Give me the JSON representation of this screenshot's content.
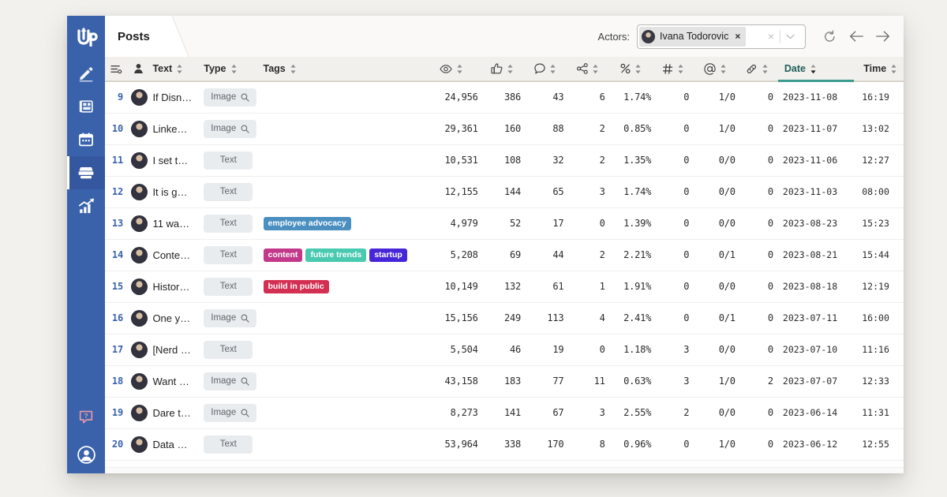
{
  "app": {
    "logo_text": "Up",
    "accent_blue": "#3a62ab",
    "accent_teal": "#3d9a8f"
  },
  "sidebar": {
    "items": [
      {
        "name": "compose",
        "icon": "pencil-icon",
        "active": false
      },
      {
        "name": "layout",
        "icon": "blueprint-icon",
        "active": false
      },
      {
        "name": "calendar",
        "icon": "calendar-icon",
        "active": false
      },
      {
        "name": "posts",
        "icon": "archive-icon",
        "active": true
      },
      {
        "name": "analytics",
        "icon": "bar-chart-icon",
        "active": false
      }
    ],
    "bottom_items": [
      {
        "name": "help",
        "icon": "help-bubble-icon"
      },
      {
        "name": "account",
        "icon": "user-circle-icon"
      }
    ]
  },
  "topbar": {
    "tab_label": "Posts",
    "actors_label": "Actors:",
    "actor_chip": "Ivana Todorovic",
    "chip_remove": "×",
    "select_clear": "×",
    "refresh_title": "Refresh",
    "back_title": "Back",
    "forward_title": "Forward"
  },
  "table": {
    "columns": [
      {
        "key": "settings",
        "label": "",
        "icon": "column-settings-icon",
        "sortable": false
      },
      {
        "key": "actor",
        "label": "",
        "icon": "person-icon",
        "sortable": false
      },
      {
        "key": "text",
        "label": "Text",
        "icon": "",
        "sortable": true
      },
      {
        "key": "type",
        "label": "Type",
        "icon": "",
        "sortable": true
      },
      {
        "key": "tags",
        "label": "Tags",
        "icon": "",
        "sortable": true
      },
      {
        "key": "views",
        "label": "",
        "icon": "eye-icon",
        "sortable": true
      },
      {
        "key": "likes",
        "label": "",
        "icon": "thumbs-up-icon",
        "sortable": true
      },
      {
        "key": "comments",
        "label": "",
        "icon": "comment-icon",
        "sortable": true
      },
      {
        "key": "shares",
        "label": "",
        "icon": "share-icon",
        "sortable": true
      },
      {
        "key": "rate",
        "label": "",
        "icon": "percent-icon",
        "sortable": true
      },
      {
        "key": "hashtags",
        "label": "",
        "icon": "hashtag-icon",
        "sortable": true
      },
      {
        "key": "mentions",
        "label": "",
        "icon": "at-icon",
        "sortable": true
      },
      {
        "key": "links",
        "label": "",
        "icon": "link-icon",
        "sortable": true
      },
      {
        "key": "date",
        "label": "Date",
        "icon": "",
        "sortable": true,
        "sorted": true
      },
      {
        "key": "time",
        "label": "Time",
        "icon": "",
        "sortable": true
      }
    ],
    "rows": [
      {
        "idx": "9",
        "text": "If Disn…",
        "type": "Image",
        "tags": [],
        "views": "24,956",
        "likes": "386",
        "comments": "43",
        "shares": "6",
        "rate": "1.74%",
        "hashtags": "0",
        "mentions": "1/0",
        "links": "0",
        "date": "2023-11-08",
        "time": "16:19"
      },
      {
        "idx": "10",
        "text": "Linke…",
        "type": "Image",
        "tags": [],
        "views": "29,361",
        "likes": "160",
        "comments": "88",
        "shares": "2",
        "rate": "0.85%",
        "hashtags": "0",
        "mentions": "1/0",
        "links": "0",
        "date": "2023-11-07",
        "time": "13:02"
      },
      {
        "idx": "11",
        "text": "I set t…",
        "type": "Text",
        "tags": [],
        "views": "10,531",
        "likes": "108",
        "comments": "32",
        "shares": "2",
        "rate": "1.35%",
        "hashtags": "0",
        "mentions": "0/0",
        "links": "0",
        "date": "2023-11-06",
        "time": "12:27"
      },
      {
        "idx": "12",
        "text": "It is g…",
        "type": "Text",
        "tags": [],
        "views": "12,155",
        "likes": "144",
        "comments": "65",
        "shares": "3",
        "rate": "1.74%",
        "hashtags": "0",
        "mentions": "0/0",
        "links": "0",
        "date": "2023-11-03",
        "time": "08:00"
      },
      {
        "idx": "13",
        "text": "11 wa…",
        "type": "Text",
        "tags": [
          {
            "label": "employee advocacy",
            "color": "#4a8fc0"
          }
        ],
        "views": "4,979",
        "likes": "52",
        "comments": "17",
        "shares": "0",
        "rate": "1.39%",
        "hashtags": "0",
        "mentions": "0/0",
        "links": "0",
        "date": "2023-08-23",
        "time": "15:23"
      },
      {
        "idx": "14",
        "text": "Conte…",
        "type": "Text",
        "tags": [
          {
            "label": "content",
            "color": "#c2398a"
          },
          {
            "label": "future trends",
            "color": "#48c9b0"
          },
          {
            "label": "startup",
            "color": "#4527d8"
          }
        ],
        "views": "5,208",
        "likes": "69",
        "comments": "44",
        "shares": "2",
        "rate": "2.21%",
        "hashtags": "0",
        "mentions": "0/1",
        "links": "0",
        "date": "2023-08-21",
        "time": "15:44"
      },
      {
        "idx": "15",
        "text": "Histor…",
        "type": "Text",
        "tags": [
          {
            "label": "build in public",
            "color": "#d32f52"
          }
        ],
        "views": "10,149",
        "likes": "132",
        "comments": "61",
        "shares": "1",
        "rate": "1.91%",
        "hashtags": "0",
        "mentions": "0/0",
        "links": "0",
        "date": "2023-08-18",
        "time": "12:19"
      },
      {
        "idx": "16",
        "text": "One y…",
        "type": "Image",
        "tags": [],
        "views": "15,156",
        "likes": "249",
        "comments": "113",
        "shares": "4",
        "rate": "2.41%",
        "hashtags": "0",
        "mentions": "0/1",
        "links": "0",
        "date": "2023-07-11",
        "time": "16:00"
      },
      {
        "idx": "17",
        "text": "[Nerd …",
        "type": "Text",
        "tags": [],
        "views": "5,504",
        "likes": "46",
        "comments": "19",
        "shares": "0",
        "rate": "1.18%",
        "hashtags": "3",
        "mentions": "0/0",
        "links": "0",
        "date": "2023-07-10",
        "time": "11:16"
      },
      {
        "idx": "18",
        "text": "Want …",
        "type": "Image",
        "tags": [],
        "views": "43,158",
        "likes": "183",
        "comments": "77",
        "shares": "11",
        "rate": "0.63%",
        "hashtags": "3",
        "mentions": "1/0",
        "links": "2",
        "date": "2023-07-07",
        "time": "12:33"
      },
      {
        "idx": "19",
        "text": "Dare t…",
        "type": "Image",
        "tags": [],
        "views": "8,273",
        "likes": "141",
        "comments": "67",
        "shares": "3",
        "rate": "2.55%",
        "hashtags": "2",
        "mentions": "0/0",
        "links": "0",
        "date": "2023-06-14",
        "time": "11:31"
      },
      {
        "idx": "20",
        "text": "Data …",
        "type": "Text",
        "tags": [],
        "views": "53,964",
        "likes": "338",
        "comments": "170",
        "shares": "8",
        "rate": "0.96%",
        "hashtags": "0",
        "mentions": "1/0",
        "links": "0",
        "date": "2023-06-12",
        "time": "12:55"
      }
    ]
  }
}
